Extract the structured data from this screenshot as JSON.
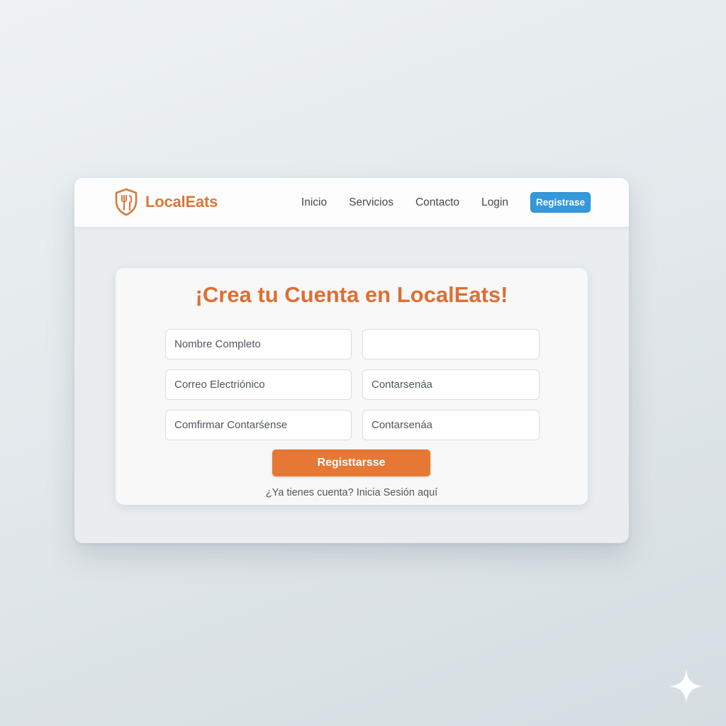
{
  "navbar": {
    "brand_name": "LocalEats",
    "logo_icon": "fork-knife-shield-icon",
    "links": [
      "Inicio",
      "Servicios",
      "Contacto",
      "Login"
    ],
    "register_button": "Registrase"
  },
  "form": {
    "title": "¡Crea tu Cuenta en LocalEats!",
    "fields": {
      "full_name": "Nombre Completo",
      "blank": "",
      "email": "Correo Electriónico",
      "password_1": "Contarsenáa",
      "confirm_password": "Comfirmar Contarśense",
      "password_2": "Contarsenáa"
    },
    "submit_button": "Registtarsse",
    "login_prompt": "¿Ya tienes cuenta? Inicia Sesión aquí"
  },
  "colors": {
    "brand_orange": "#dd6f33",
    "button_orange": "#e67835",
    "nav_button_blue": "#3498db"
  },
  "decor": {
    "corner_icon": "sparkle-icon"
  }
}
